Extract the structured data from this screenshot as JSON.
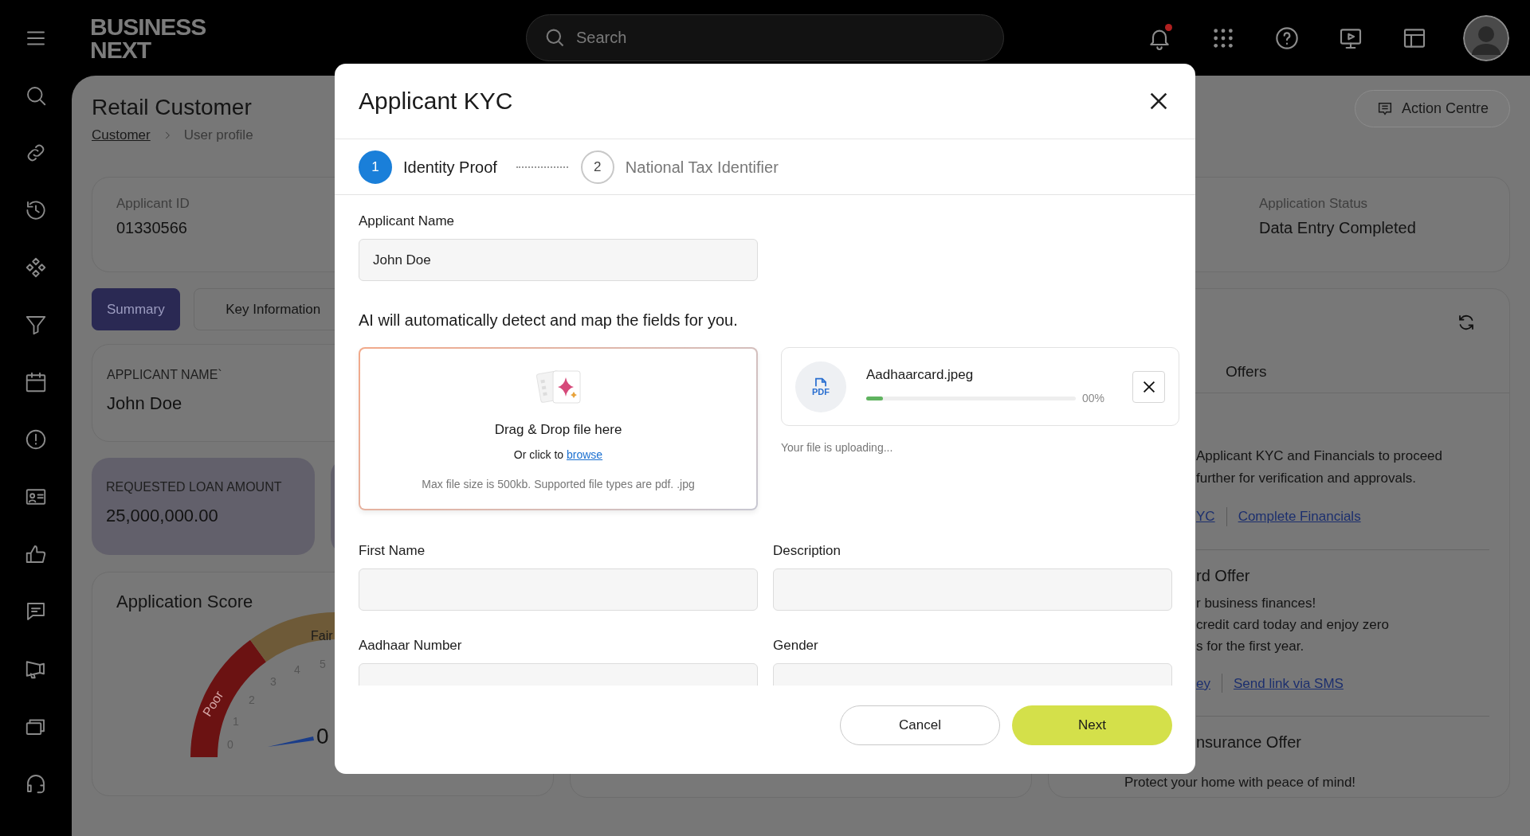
{
  "topbar": {
    "logo_lines": [
      "BUSINESS",
      "NEXT"
    ],
    "search": {
      "placeholder": "Search"
    },
    "notification_dot": true
  },
  "page": {
    "title": "Retail Customer",
    "breadcrumb": [
      {
        "label": "Customer",
        "kind": "link"
      },
      {
        "label": "User profile",
        "kind": "current"
      }
    ],
    "action_button": "Action Centre"
  },
  "summary_card": {
    "fields": [
      {
        "label": "Applicant ID",
        "value": "01330566"
      },
      {
        "label": "Application Status",
        "value": "Data Entry Completed"
      }
    ]
  },
  "tabs": [
    {
      "label": "Summary",
      "selected": true
    },
    {
      "label": "Key Information",
      "selected": false
    }
  ],
  "applicant_name_card": {
    "label": "APPLICANT NAME`",
    "value": "John Doe"
  },
  "loan_card": {
    "label": "REQUESTED LOAN AMOUNT",
    "value": "25,000,000.00"
  },
  "score_card": {
    "title": "Application Score",
    "zones": [
      "Poor",
      "Fair"
    ],
    "ticks": [
      "0",
      "1",
      "2",
      "3",
      "4",
      "5"
    ],
    "value": "0"
  },
  "offers_panel": {
    "tabs": [
      {
        "label": "Offers",
        "selected": false
      }
    ],
    "sections": [
      {
        "text": "Applicant KYC and Financials to proceed\nfurther for verification and approvals.",
        "links": [
          "YC",
          "Complete Financials"
        ]
      },
      {
        "title": "rd Offer",
        "text": "r business finances!\ncredit card today and enjoy zero\ns for the first year.",
        "links": [
          "ey",
          "Send link via SMS"
        ]
      },
      {
        "title": "nsurance Offer",
        "text": "Protect your home with peace of mind!"
      }
    ]
  },
  "modal": {
    "title": "Applicant KYC",
    "steps": [
      {
        "number": "1",
        "label": "Identity Proof",
        "selected": true
      },
      {
        "number": "2",
        "label": "National Tax Identifier",
        "selected": false
      }
    ],
    "applicant_name": {
      "label": "Applicant Name",
      "value": "John Doe"
    },
    "ai_note": "AI will automatically detect and map the fields for you.",
    "dropzone": {
      "title": "Drag & Drop file here",
      "prompt": "Or click to",
      "link": "browse",
      "hint": "Max file size is 500kb. Supported file types are pdf. .jpg"
    },
    "upload": {
      "badge": "PDF",
      "file_name": "Aadhaarcard.jpeg",
      "level": 0.08,
      "percent": "00%",
      "status": "Your file is uploading..."
    },
    "fields": [
      {
        "label": "First Name"
      },
      {
        "label": "Description"
      },
      {
        "label": "Aadhaar Number"
      },
      {
        "label": "Gender"
      }
    ],
    "buttons": [
      {
        "label": "Cancel",
        "kind": "secondary"
      },
      {
        "label": "Next",
        "kind": "primary"
      }
    ]
  }
}
